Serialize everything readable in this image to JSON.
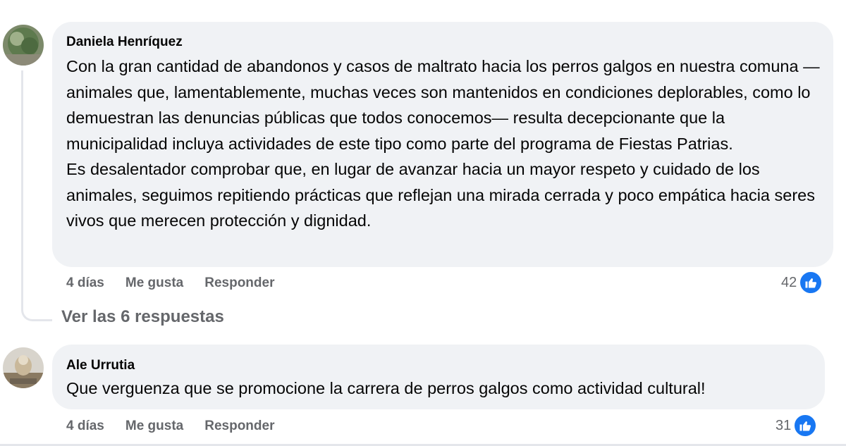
{
  "comments": [
    {
      "author": "Daniela Henríquez",
      "paragraphs": [
        "Con la gran cantidad de abandonos y casos de maltrato hacia los perros galgos en nuestra comuna —animales que, lamentablemente, muchas veces son mantenidos en condiciones deplorables, como lo demuestran las denuncias públicas que todos conocemos— resulta decepcionante que la municipalidad incluya actividades de este tipo como parte del programa de Fiestas Patrias.",
        "Es desalentador comprobar que, en lugar de avanzar hacia un mayor respeto y cuidado de los animales, seguimos repitiendo prácticas que reflejan una mirada cerrada y poco empática hacia seres vivos que merecen protección y dignidad."
      ],
      "time": "4 días",
      "like_label": "Me gusta",
      "reply_label": "Responder",
      "reaction_count": "42",
      "reaction_icon": "thumbs-up-icon",
      "avatar_icon": "profile-photo"
    },
    {
      "author": "Ale Urrutia",
      "paragraphs": [
        "Que verguenza que se promocione la carrera de perros galgos como actividad cultural!"
      ],
      "time": "4 días",
      "like_label": "Me gusta",
      "reply_label": "Responder",
      "reaction_count": "31",
      "reaction_icon": "thumbs-up-icon",
      "avatar_icon": "profile-photo"
    }
  ],
  "replies_link": "Ver las 6 respuestas",
  "colors": {
    "bubble": "#f0f2f5",
    "secondary_text": "#65676b",
    "like_blue": "#1877f2",
    "thread_line": "#e4e6eb"
  }
}
